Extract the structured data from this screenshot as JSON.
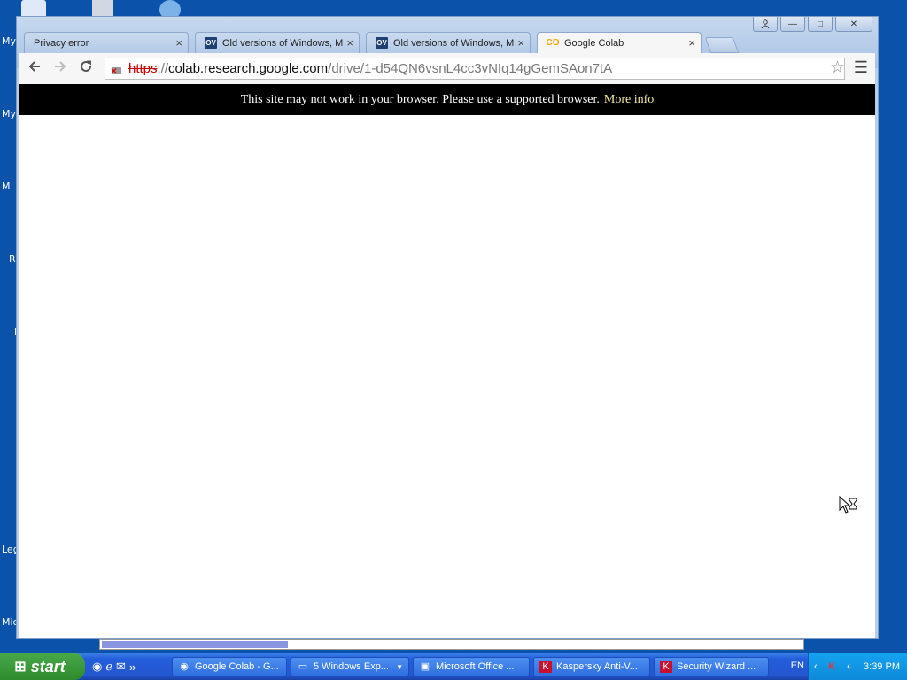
{
  "desktop": {
    "labels": [
      "My",
      "My",
      "M",
      "R",
      "I",
      "Leg",
      "Mic"
    ]
  },
  "window": {
    "controls": {
      "user": "user-icon",
      "minimize": "—",
      "maximize": "□",
      "close": "✕"
    }
  },
  "tabs": [
    {
      "label": "Privacy error",
      "icon": "page-icon",
      "close": "×"
    },
    {
      "label": "Old versions of Windows, Ma",
      "icon": "oldversion-icon",
      "icon_text": "OV",
      "close": "×"
    },
    {
      "label": "Old versions of Windows, Ma",
      "icon": "oldversion-icon",
      "icon_text": "OV",
      "close": "×"
    },
    {
      "label": "Google Colab",
      "icon": "colab-icon",
      "icon_text": "CO",
      "close": "×"
    }
  ],
  "omnibox": {
    "scheme": "https",
    "separator": "://",
    "host": "colab.research.google.com",
    "path": "/drive/1-d54QN6vsnL4cc3vNIq14gGemSAon7tA"
  },
  "notice": {
    "text": "This site may not work in your browser. Please use a supported browser.",
    "link": "More info"
  },
  "taskbar": {
    "start": "start",
    "tasks": [
      {
        "label": "Google Colab - G...",
        "icon": "chrome-icon"
      },
      {
        "label": "5 Windows Exp...",
        "icon": "folder-icon"
      },
      {
        "label": "Microsoft Office ...",
        "icon": "office-icon"
      },
      {
        "label": "Kaspersky Anti-V...",
        "icon": "kaspersky-icon"
      },
      {
        "label": "Security Wizard ...",
        "icon": "kaspersky-icon"
      }
    ],
    "language": "EN",
    "clock": "3:39 PM"
  },
  "colors": {
    "desktop": "#0b52aa",
    "notice_bg": "#000000",
    "notice_link": "#f4e8a3",
    "scheme_error": "#cc0000"
  }
}
